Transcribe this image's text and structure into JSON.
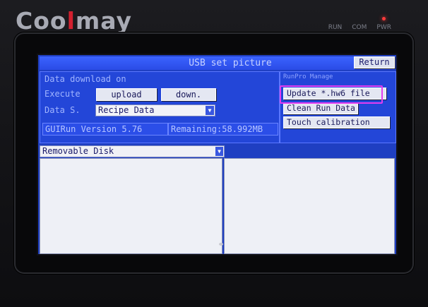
{
  "device": {
    "brand_prefix": "Coo",
    "brand_accent": "l",
    "brand_suffix": "may",
    "indicators": [
      "RUN",
      "COM",
      "PWR"
    ],
    "pwr_led_color": "#ff3a3a"
  },
  "screen": {
    "title": "USB set picture",
    "return_label": "Return",
    "left_panel": {
      "download_label": "Data download on",
      "execute_label": "Execute",
      "upload_label": "upload",
      "down_label": "down.",
      "data_source_label": "Data S.",
      "data_source_value": "Recipe Data",
      "version_text": "GUIRun Version 5.76",
      "remaining_text": "Remaining:58.992MB"
    },
    "right_panel": {
      "header": "RunPro Manage",
      "buttons": [
        "Update *.hw6 file",
        "Clean Run Data",
        "Touch calibration"
      ]
    },
    "drive_select_value": "Removable Disk",
    "highlight_color": "#e33cf0"
  }
}
